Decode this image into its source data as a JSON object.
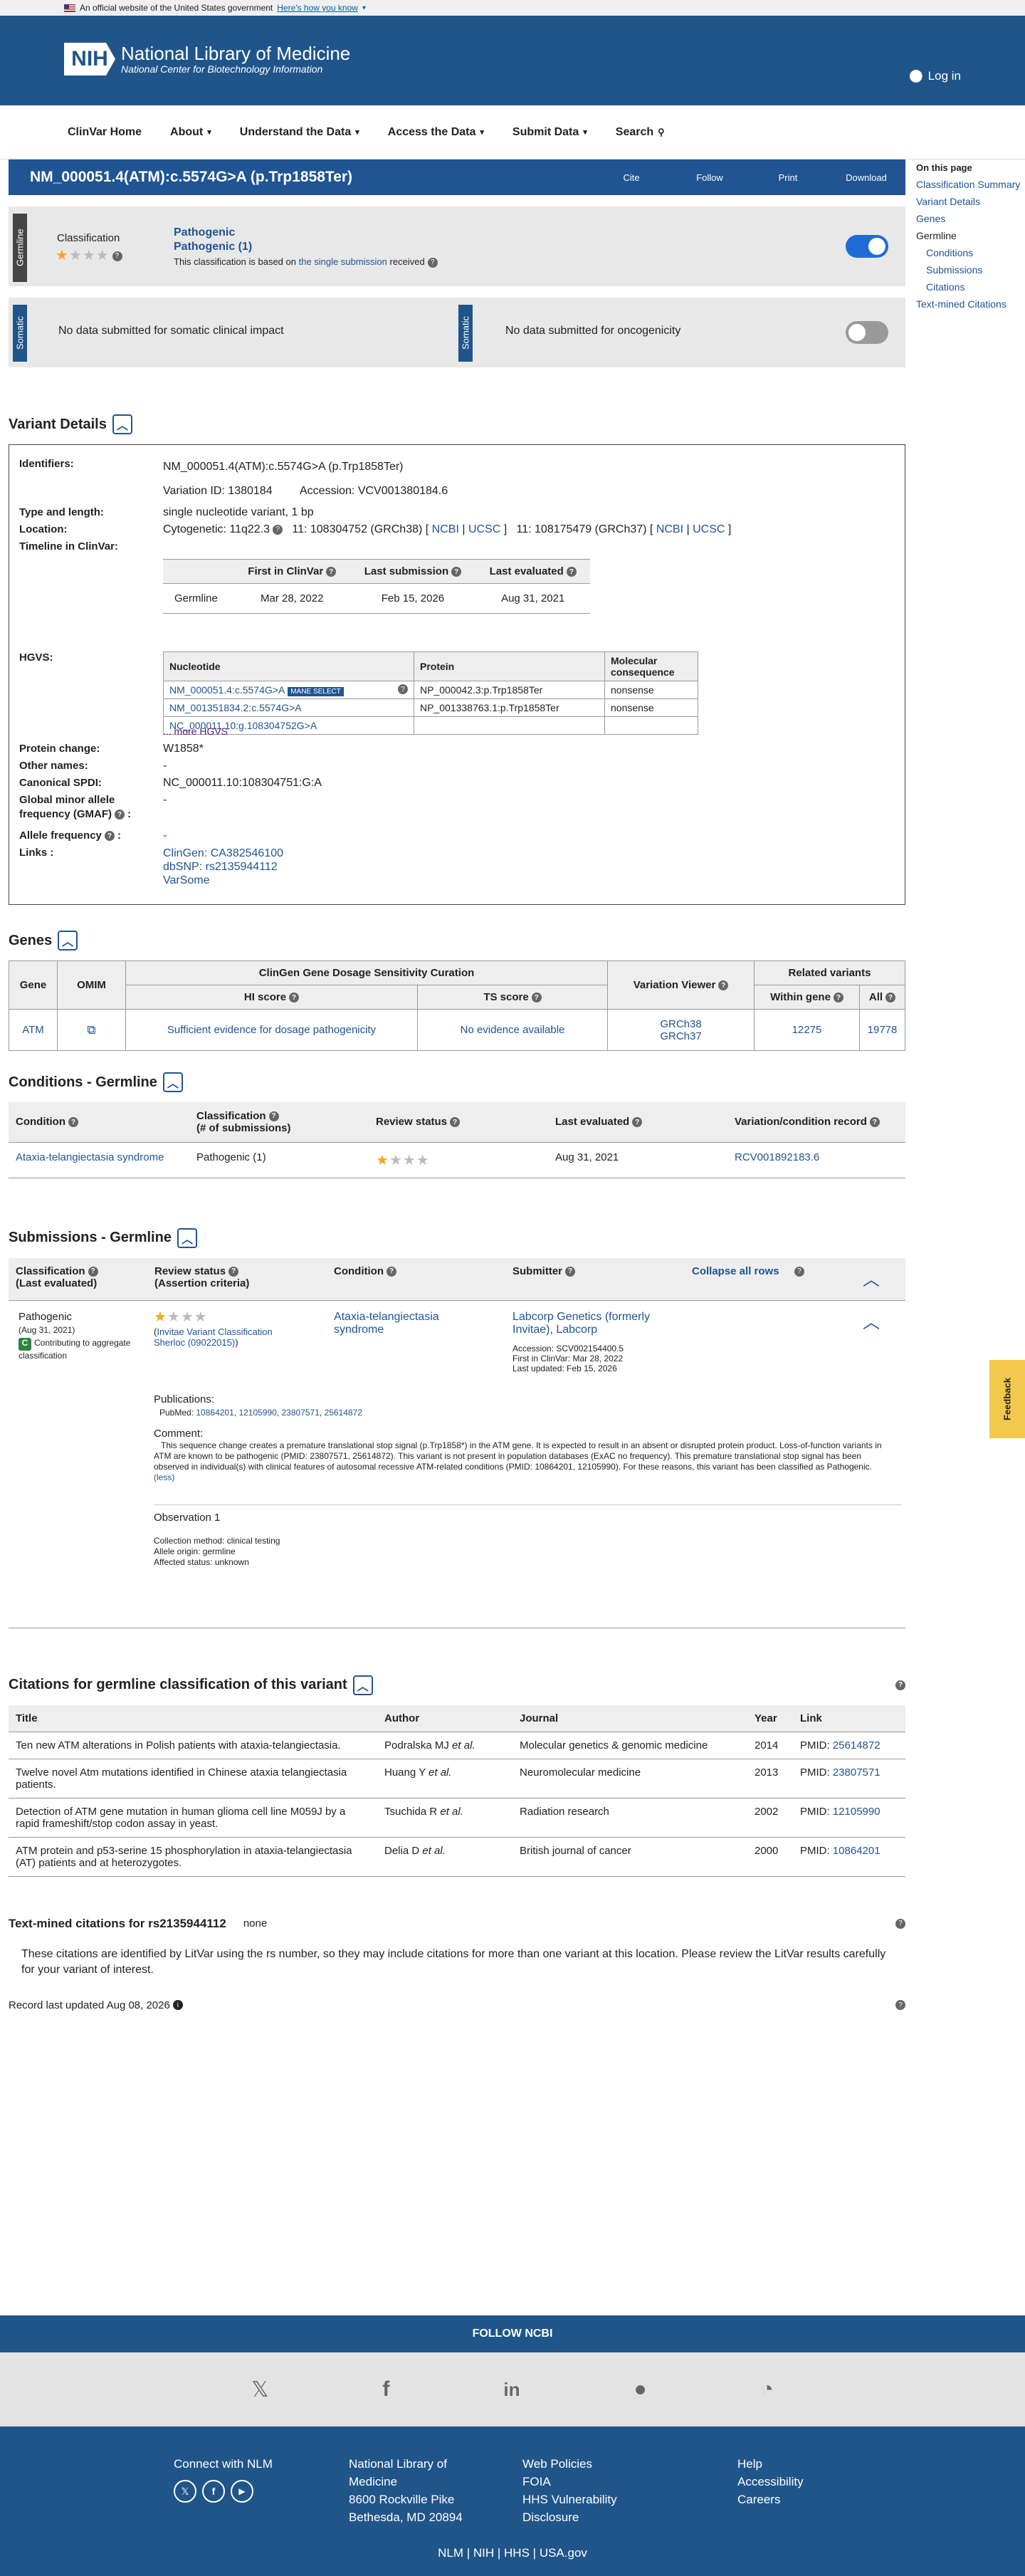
{
  "banner": {
    "text": "An official website of the United States government",
    "link": "Here's how you know"
  },
  "header": {
    "logo": "NIH",
    "title": "National Library of Medicine",
    "subtitle": "National Center for Biotechnology Information",
    "login": "Log in"
  },
  "nav": [
    "ClinVar Home",
    "About",
    "Understand the Data",
    "Access the Data",
    "Submit Data",
    "Search"
  ],
  "title": {
    "text": "NM_000051.4(ATM):c.5574G>A (p.Trp1858Ter)",
    "actions": [
      "Cite",
      "Follow",
      "Print",
      "Download"
    ]
  },
  "germline": {
    "side": "Germline",
    "label": "Classification",
    "cls1": "Pathogenic",
    "cls2": "Pathogenic (1)",
    "basis_pre": "This classification is based on",
    "basis_link": "the single submission",
    "basis_post": "received"
  },
  "somatic": {
    "side": "Somatic",
    "clinical": "No data submitted for somatic clinical impact",
    "side2": "Somatic",
    "onco": "No data submitted for oncogenicity"
  },
  "rightnav": {
    "head": "On this page",
    "items": [
      "Classification Summary",
      "Variant Details",
      "Genes",
      "Germline",
      "Conditions",
      "Submissions",
      "Citations",
      "Text-mined Citations"
    ]
  },
  "vd": {
    "heading": "Variant Details",
    "identifiers_label": "Identifiers:",
    "identifiers": "NM_000051.4(ATM):c.5574G>A (p.Trp1858Ter)",
    "variation_id": "Variation ID: 1380184",
    "accession": "Accession: VCV001380184.6",
    "type_label": "Type and length:",
    "type": "single nucleotide variant, 1 bp",
    "location_label": "Location:",
    "cyto": "Cytogenetic: 11q22.3",
    "grch38": "11: 108304752 (GRCh38) [",
    "ncbi": "NCBI",
    "ucsc": "UCSC",
    "close": "]",
    "grch37": "11: 108175479 (GRCh37) [",
    "timeline_label": "Timeline in ClinVar:",
    "timeline_headers": [
      "First in ClinVar",
      "Last submission",
      "Last evaluated"
    ],
    "timeline_row": [
      "Germline",
      "Mar 28, 2022",
      "Feb 15, 2026",
      "Aug 31, 2021"
    ],
    "hgvs_label": "HGVS:",
    "hgvs_headers": [
      "Nucleotide",
      "Protein",
      "Molecular consequence"
    ],
    "hgvs_rows": [
      [
        "NM_000051.4:c.5574G>A",
        "NP_000042.3:p.Trp1858Ter",
        "nonsense"
      ],
      [
        "NM_001351834.2:c.5574G>A",
        "NP_001338763.1:p.Trp1858Ter",
        "nonsense"
      ],
      [
        "NC_000011.10:g.108304752G>A",
        "",
        ""
      ]
    ],
    "mane": "MANE SELECT",
    "more": "... more HGVS",
    "protein_label": "Protein change:",
    "protein": "W1858*",
    "other_label": "Other names:",
    "other": "-",
    "spdi_label": "Canonical SPDI:",
    "spdi": "NC_000011.10:108304751:G:A",
    "gmaf_label1": "Global minor allele",
    "gmaf_label2": "frequency (GMAF)",
    "gmaf": "-",
    "af_label": "Allele frequency",
    "af": "-",
    "links_label": "Links :",
    "links": [
      "ClinGen: CA382546100",
      "dbSNP: rs2135944112",
      "VarSome"
    ]
  },
  "genes": {
    "heading": "Genes",
    "h_gene": "Gene",
    "h_omim": "OMIM",
    "h_clingen": "ClinGen Gene Dosage Sensitivity Curation",
    "h_hi": "HI score",
    "h_ts": "TS score",
    "h_viewer": "Variation Viewer",
    "h_related": "Related variants",
    "h_within": "Within gene",
    "h_all": "All",
    "gene": "ATM",
    "hi": "Sufficient evidence for dosage pathogenicity",
    "ts": "No evidence available",
    "v1": "GRCh38",
    "v2": "GRCh37",
    "within": "12275",
    "all": "19778"
  },
  "conditions": {
    "heading": "Conditions - Germline",
    "headers": [
      "Condition",
      "Classification",
      "(# of submissions)",
      "Review status",
      "Last evaluated",
      "Variation/condition record"
    ],
    "condition": "Ataxia-telangiectasia syndrome",
    "cls": "Pathogenic (1)",
    "evaluated": "Aug 31, 2021",
    "record": "RCV001892183.6"
  },
  "submissions": {
    "heading": "Submissions - Germline",
    "h_cls": "Classification",
    "h_cls2": "(Last evaluated)",
    "h_rev": "Review status",
    "h_rev2": "(Assertion criteria)",
    "h_cond": "Condition",
    "h_sub": "Submitter",
    "collapse": "Collapse all rows",
    "cls": "Pathogenic",
    "date": "(Aug 31, 2021)",
    "contrib": "Contributing to aggregate classification",
    "contrib_badge": "C",
    "criteria": "Invitae Variant Classification Sherloc (09022015)",
    "condition": "Ataxia-telangiectasia syndrome",
    "submitter": "Labcorp Genetics (formerly Invitae), Labcorp",
    "acc": "Accession: SCV002154400.5",
    "first": "First in ClinVar: Mar 28, 2022",
    "updated": "Last updated: Feb 15, 2026",
    "pub_label": "Publications:",
    "pubmed": "PubMed:",
    "pmids": [
      "10864201",
      "12105990",
      "23807571",
      "25614872"
    ],
    "comment_label": "Comment:",
    "comment": "This sequence change creates a premature translational stop signal (p.Trp1858*) in the ATM gene. It is expected to result in an absent or disrupted protein product. Loss-of-function variants in ATM are known to be pathogenic (PMID: 23807571, 25614872). This variant is not present in population databases (ExAC no frequency). This premature translational stop signal has been observed in individual(s) with clinical features of autosomal recessive ATM-related conditions (PMID: 10864201, 12105990). For these reasons, this variant has been classified as Pathogenic.",
    "less": "(less)",
    "obs": "Observation 1",
    "method": "Collection method: clinical testing",
    "origin": "Allele origin: germline",
    "affected": "Affected status: unknown"
  },
  "citations": {
    "heading": "Citations for germline classification of this variant",
    "headers": [
      "Title",
      "Author",
      "Journal",
      "Year",
      "Link"
    ],
    "rows": [
      {
        "title": "Ten new ATM alterations in Polish patients with ataxia-telangiectasia.",
        "author": "Podralska MJ",
        "etal": "et al.",
        "journal": "Molecular genetics & genomic medicine",
        "year": "2014",
        "pmid": "25614872"
      },
      {
        "title": "Twelve novel Atm mutations identified in Chinese ataxia telangiectasia patients.",
        "author": "Huang Y",
        "etal": "et al.",
        "journal": "Neuromolecular medicine",
        "year": "2013",
        "pmid": "23807571"
      },
      {
        "title": "Detection of ATM gene mutation in human glioma cell line M059J by a rapid frameshift/stop codon assay in yeast.",
        "author": "Tsuchida R",
        "etal": "et al.",
        "journal": "Radiation research",
        "year": "2002",
        "pmid": "12105990"
      },
      {
        "title": "ATM protein and p53-serine 15 phosphorylation in ataxia-telangiectasia (AT) patients and at heterozygotes.",
        "author": "Delia D",
        "etal": "et al.",
        "journal": "British journal of cancer",
        "year": "2000",
        "pmid": "10864201"
      }
    ],
    "pmid_label": "PMID:"
  },
  "textmined": {
    "heading": "Text-mined citations for rs2135944112",
    "none": "none",
    "desc": "These citations are identified by LitVar using the rs number, so they may include citations for more than one variant at this location. Please review the LitVar results carefully for your variant of interest."
  },
  "updated": "Record last updated Aug 08, 2026",
  "feedback": "Feedback",
  "footer": {
    "follow": "FOLLOW NCBI",
    "connect": "Connect with NLM",
    "nlm": [
      "National Library of",
      "Medicine",
      "8600 Rockville Pike",
      "Bethesda, MD 20894"
    ],
    "policies": [
      "Web Policies",
      "FOIA",
      "HHS Vulnerability",
      "Disclosure"
    ],
    "help": [
      "Help",
      "Accessibility",
      "Careers"
    ],
    "bottom": [
      "NLM",
      "NIH",
      "HHS",
      "USA.gov"
    ]
  }
}
